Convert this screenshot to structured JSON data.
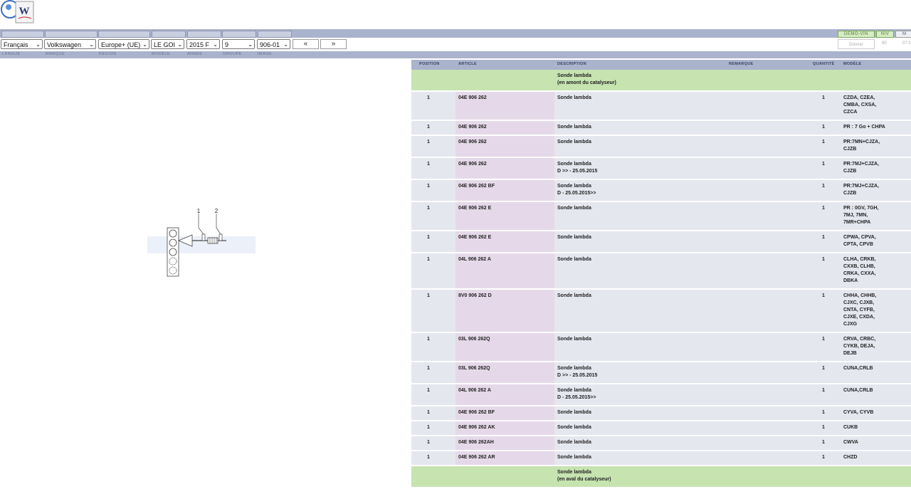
{
  "logo": {
    "text": "W"
  },
  "header": {
    "demo_vin": "DEMO-VIN",
    "niv": "NIV",
    "m": "M",
    "donner": "Donner",
    "num1": "90",
    "num2": "07:3"
  },
  "selectors": {
    "langue": "Français",
    "marque": "Volkswagen",
    "region": "Europe+ (UE)",
    "modele": "LE GOI",
    "annee": "2015 F",
    "groupe": "9",
    "image": "906-01",
    "prev": "«",
    "next": "»"
  },
  "labels": {
    "langue": "LANGUE",
    "marque": "MARQUE",
    "region": "RÉGION",
    "modele": "MODÈLE",
    "annee": "ANNÉE",
    "groupe": "GROUPE",
    "image": "IMAGE"
  },
  "diagram": {
    "callout1": "1",
    "callout2": "2"
  },
  "table": {
    "headers": {
      "position": "POSITION",
      "article": "ARTICLE",
      "description": "DESCRIPTION",
      "remarque": "REMARQUE",
      "quantite": "QUANTITÉ",
      "modele": "MODÈLE"
    },
    "rows": [
      {
        "group": true,
        "desc": "Sonde lambda\n(en amont du catalyseur)"
      },
      {
        "pos": "1",
        "art": "04E 906 262",
        "desc": "Sonde lambda",
        "qty": "1",
        "mod": "CZDA, CZEA,\nCMBA, CXSA,\nCZCA"
      },
      {
        "pos": "1",
        "art": "04E 906 262",
        "desc": "Sonde lambda",
        "qty": "1",
        "mod": "PR : 7 Go + CHPA"
      },
      {
        "pos": "1",
        "art": "04E 906 262",
        "desc": "Sonde lambda",
        "qty": "1",
        "mod": "PR:7MN+CJZA,\nCJZB"
      },
      {
        "pos": "1",
        "art": "04E 906 262",
        "desc": "Sonde lambda\nD >> - 25.05.2015",
        "qty": "1",
        "mod": "PR:7MJ+CJZA,\nCJZB"
      },
      {
        "pos": "1",
        "art": "04E 906 262 BF",
        "desc": "Sonde lambda\nD - 25.05.2015>>",
        "qty": "1",
        "mod": "PR:7MJ+CJZA,\nCJZB"
      },
      {
        "pos": "1",
        "art": "04E 906 262 E",
        "desc": "Sonde lambda",
        "qty": "1",
        "mod": "PR : 0GV, 7GH,\n7MJ, 7MN,\n7MR+CHPA"
      },
      {
        "pos": "1",
        "art": "04E 906 262 E",
        "desc": "Sonde lambda",
        "qty": "1",
        "mod": "CPWA, CPVA,\nCPTA, CPVB"
      },
      {
        "pos": "1",
        "art": "04L 906 262 A",
        "desc": "Sonde lambda",
        "qty": "1",
        "mod": "CLHA, CRKB,\nCXXB, CLHB,\nCRKA, CXXA,\nDBKA"
      },
      {
        "pos": "1",
        "art": "8V0 906 262 D",
        "desc": "Sonde lambda",
        "qty": "1",
        "mod": "CHHA, CHHB,\nCJXC, CJXB,\nCNTA, CYFB,\nCJXE, CXDA,\nCJXG"
      },
      {
        "pos": "1",
        "art": "03L 906 262Q",
        "desc": "Sonde lambda",
        "qty": "1",
        "mod": "CRVA, CRBC,\nCYKB, DEJA,\nDEJB"
      },
      {
        "pos": "1",
        "art": "03L 906 262Q",
        "desc": "Sonde lambda\nD >> - 25.05.2015",
        "qty": "1",
        "mod": "CUNA,CRLB"
      },
      {
        "pos": "1",
        "art": "04L 906 262 A",
        "desc": "Sonde lambda\nD - 25.05.2015>>",
        "qty": "1",
        "mod": "CUNA,CRLB"
      },
      {
        "pos": "1",
        "art": "04E 906 262 BF",
        "desc": "Sonde lambda",
        "qty": "1",
        "mod": "CYVA, CYVB"
      },
      {
        "pos": "1",
        "art": "04E 906 262 AK",
        "desc": "Sonde lambda",
        "qty": "1",
        "mod": "CUKB"
      },
      {
        "pos": "1",
        "art": "04E 906 262AH",
        "desc": "Sonde lambda",
        "qty": "1",
        "mod": "CWVA"
      },
      {
        "pos": "1",
        "art": "04E 906 262 AR",
        "desc": "Sonde lambda",
        "qty": "1",
        "mod": "CHZD"
      },
      {
        "group": true,
        "desc": "Sonde lambda\n(en aval du catalyseur)"
      }
    ]
  }
}
